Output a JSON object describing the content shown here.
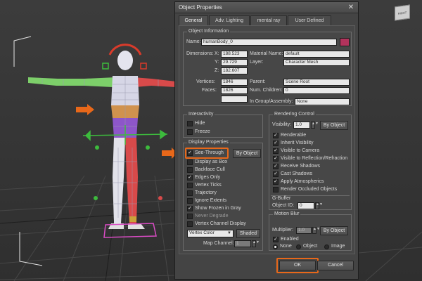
{
  "colors": {
    "accent": "#e8681a",
    "swatch": "#b2335c",
    "mesh": "#e8e8f0"
  },
  "viewport": {
    "nav_cube_label": "RIGHT"
  },
  "dialog": {
    "title": "Object Properties",
    "close_label": "✕",
    "tabs": [
      {
        "label": "General",
        "active": true
      },
      {
        "label": "Adv. Lighting"
      },
      {
        "label": "mental ray"
      },
      {
        "label": "User Defined"
      }
    ],
    "object_info": {
      "legend": "Object Information",
      "name_label": "Name:",
      "name_value": "humanBody_0",
      "dimensions_label": "Dimensions:",
      "x_label": "X:",
      "x_value": "188.523",
      "y_label": "Y:",
      "y_value": "29.729",
      "z_label": "Z:",
      "z_value": "182.607",
      "material_name_label": "Material Name:",
      "material_name_value": "default",
      "layer_label": "Layer:",
      "layer_value": "Character Mesh",
      "vertices_label": "Vertices:",
      "vertices_value": "1846",
      "faces_label": "Faces:",
      "faces_value": "1826",
      "parent_label": "Parent:",
      "parent_value": "Scene Root",
      "num_children_label": "Num. Children:",
      "num_children_value": "0",
      "group_label": "In Group/Assembly:",
      "group_value": "None"
    },
    "interactivity": {
      "legend": "Interactivity",
      "items": [
        {
          "label": "Hide",
          "checked": false
        },
        {
          "label": "Freeze",
          "checked": false
        }
      ]
    },
    "display_properties": {
      "legend": "Display Properties",
      "by_object_label": "By Object",
      "items": [
        {
          "label": "See-Through",
          "checked": true
        },
        {
          "label": "Display as Box",
          "checked": false
        },
        {
          "label": "Backface Cull",
          "checked": false
        },
        {
          "label": "Edges Only",
          "checked": true
        },
        {
          "label": "Vertex Ticks",
          "checked": false
        },
        {
          "label": "Trajectory",
          "checked": false
        },
        {
          "label": "Ignore Extents",
          "checked": false
        },
        {
          "label": "Show Frozen in Gray",
          "checked": true
        },
        {
          "label": "Never Degrade",
          "checked": false
        },
        {
          "label": "Vertex Channel Display",
          "checked": false
        }
      ],
      "vertex_color_value": "Vertex Color",
      "shaded_label": "Shaded",
      "map_channel_label": "Map Channel:",
      "map_channel_value": "1"
    },
    "rendering_control": {
      "legend": "Rendering Control",
      "visibility_label": "Visibility:",
      "visibility_value": "1.0",
      "by_object_label": "By Object",
      "items": [
        {
          "label": "Renderable",
          "checked": true
        },
        {
          "label": "Inherit Visibility",
          "checked": true
        },
        {
          "label": "Visible to Camera",
          "checked": true
        },
        {
          "label": "Visible to Reflection/Refraction",
          "checked": true
        },
        {
          "label": "Receive Shadows",
          "checked": true
        },
        {
          "label": "Cast Shadows",
          "checked": true
        },
        {
          "label": "Apply Atmospherics",
          "checked": true
        },
        {
          "label": "Render Occluded Objects",
          "checked": false
        }
      ]
    },
    "gbuffer": {
      "legend": "G-Buffer",
      "object_id_label": "Object ID:",
      "object_id_value": "0"
    },
    "motion_blur": {
      "legend": "Motion Blur",
      "multiplier_label": "Multiplier:",
      "multiplier_value": "1.0",
      "by_object_label": "By Object",
      "enabled_label": "Enabled",
      "enabled_checked": true,
      "radios": [
        {
          "label": "None",
          "selected": true
        },
        {
          "label": "Object",
          "selected": false
        },
        {
          "label": "Image",
          "selected": false
        }
      ]
    },
    "ok_label": "OK",
    "cancel_label": "Cancel"
  }
}
